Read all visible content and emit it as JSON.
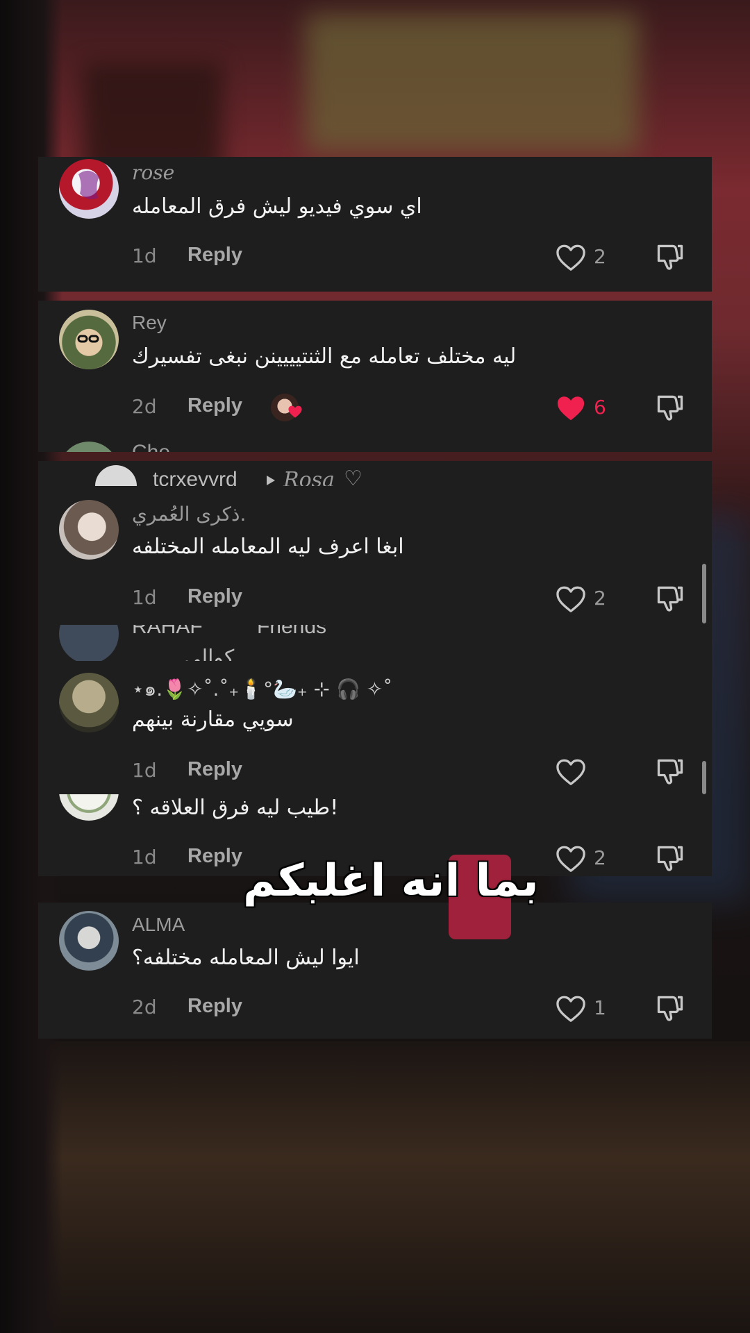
{
  "colors": {
    "panel": "#1e1e1e",
    "like_active": "#f0214f",
    "muted": "#8a8a8a"
  },
  "panel1": {
    "comment": {
      "username": "rose",
      "text": "اي سوي فيديو ليش فرق المعامله",
      "time": "1d",
      "reply": "Reply",
      "likes": "2",
      "liked": false
    }
  },
  "panel2": {
    "comment": {
      "username": "Rey",
      "text": "ليه مختلف تعامله مع الثنتيييينن نبغى تفسيرك",
      "time": "2d",
      "reply": "Reply",
      "likes": "6",
      "liked": true
    },
    "partial_username": "Che"
  },
  "panel3": {
    "reply_header": {
      "username": "tcrxeyyrd",
      "target": "Rosa",
      "heart_glyph": "♡"
    },
    "comments": [
      {
        "username": "ذكرى العُمري.",
        "text": "ابغا اعرف ليه المعامله المختلفه",
        "time": "1d",
        "reply": "Reply",
        "likes": "2"
      },
      {
        "partial_username": "RAHAF",
        "partial_tag": "Friends",
        "partial_text": "كوالي"
      },
      {
        "username": "⋆๑.🌷✧˚.˚₊🕯️°🦢₊ ⊹ 🎧 ✧˚",
        "text": "سويي مقارنة بينهم",
        "time": "1d",
        "reply": "Reply",
        "likes": ""
      },
      {
        "text": "طيب ليه فرق العلاقه ؟!",
        "time": "1d",
        "reply": "Reply",
        "likes": "2"
      }
    ]
  },
  "panel4": {
    "comment": {
      "username": "ALMA",
      "text": "ايوا ليش المعامله مختلفه؟",
      "time": "2d",
      "reply": "Reply",
      "likes": "1"
    }
  },
  "caption": {
    "text": "بما انه اغلبكم"
  },
  "icons": [
    "heart-outline-icon",
    "heart-filled-icon",
    "thumbs-down-icon",
    "play-triangle-icon"
  ]
}
